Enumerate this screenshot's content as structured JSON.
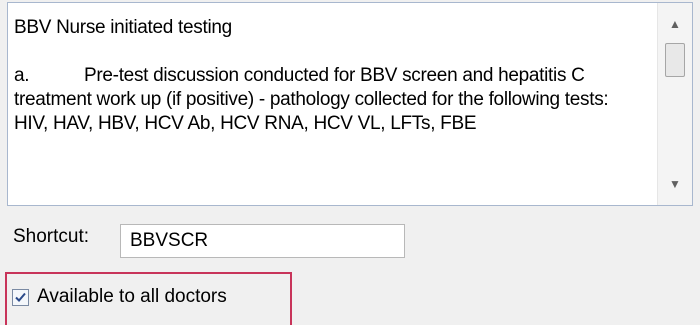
{
  "note": {
    "text": "BBV Nurse initiated testing\n\na.           Pre-test discussion conducted for BBV screen and hepatitis C treatment work up (if positive) - pathology collected for the following tests: HIV, HAV, HBV, HCV Ab, HCV RNA, HCV VL, LFTs, FBE"
  },
  "shortcut": {
    "label": "Shortcut:",
    "value": "BBVSCR"
  },
  "availability": {
    "label": "Available to all doctors",
    "checked": true
  },
  "colors": {
    "highlight": "#c8345a",
    "textarea_border": "#a8b7ce"
  },
  "icons": {
    "scroll_up": "scroll-up-arrow-icon",
    "scroll_down": "scroll-down-arrow-icon",
    "check": "checkmark-icon"
  }
}
